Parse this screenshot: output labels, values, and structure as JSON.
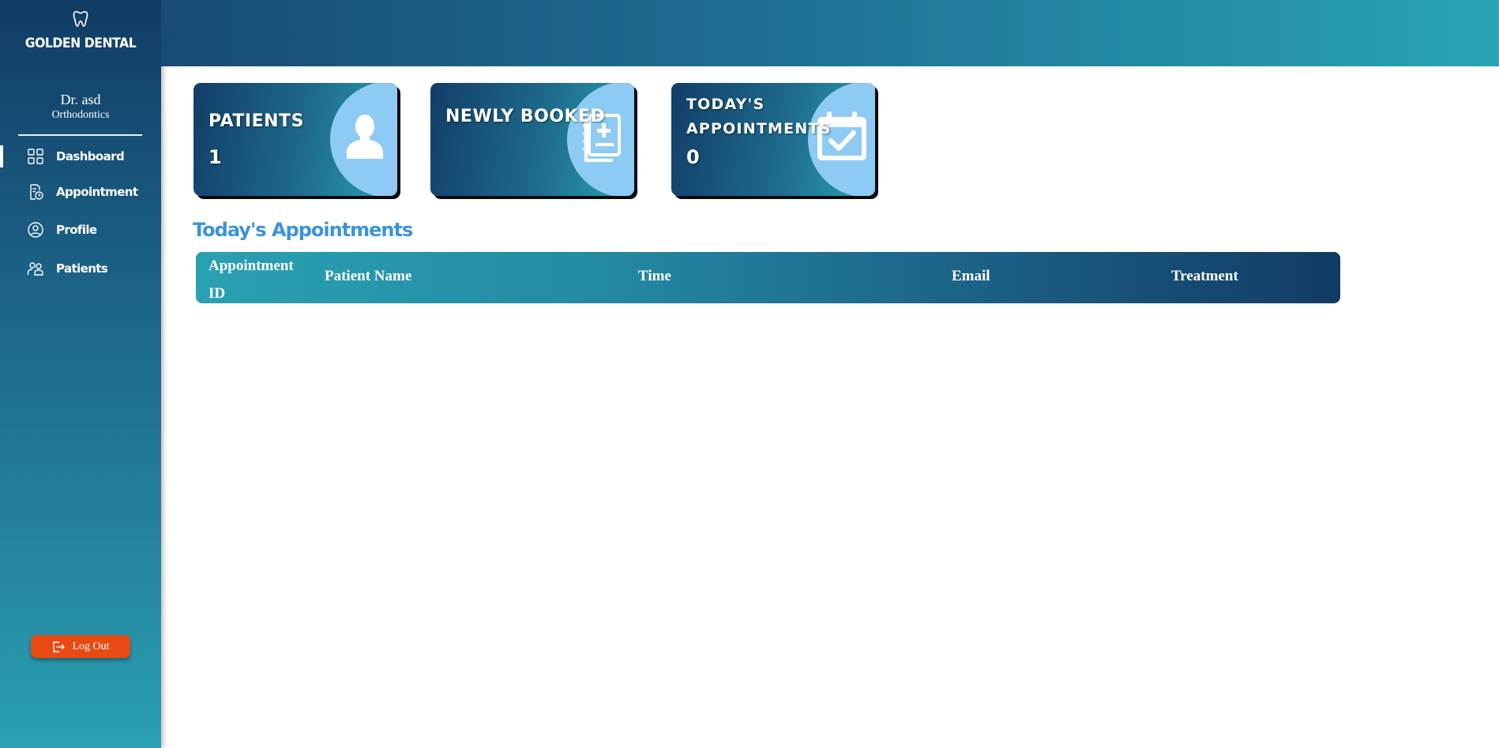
{
  "sidebar": {
    "brand": "GOLDEN DENTAL",
    "doctor_name": "Dr. asd",
    "doctor_specialty": "Orthodontics",
    "nav": [
      {
        "label": "Dashboard",
        "icon": "grid-icon",
        "active": true
      },
      {
        "label": "Appointment",
        "icon": "appointment-icon",
        "active": false
      },
      {
        "label": "Profile",
        "icon": "user-circle-icon",
        "active": false
      },
      {
        "label": "Patients",
        "icon": "users-icon",
        "active": false
      }
    ],
    "logout_label": "Log Out"
  },
  "cards": [
    {
      "title": "PATIENTS",
      "value": "1",
      "icon": "user-silhouette-icon"
    },
    {
      "title": "NEWLY BOOKED",
      "value": "",
      "icon": "notebook-plus-icon"
    },
    {
      "title_line1": "TODAY'S",
      "title_line2": "APPOINTMENTS",
      "value": "0",
      "icon": "calendar-check-icon"
    }
  ],
  "appointments": {
    "title": "Today's Appointments",
    "columns": [
      "Appointment ID",
      "Patient Name",
      "Time",
      "Email",
      "Treatment"
    ],
    "rows": []
  },
  "colors": {
    "sidebar_top": "#113b64",
    "sidebar_bottom": "#2aa1b3",
    "accent_blue": "#3b93d8",
    "card_disc": "#8ecbf4",
    "logout": "#e94a14"
  }
}
